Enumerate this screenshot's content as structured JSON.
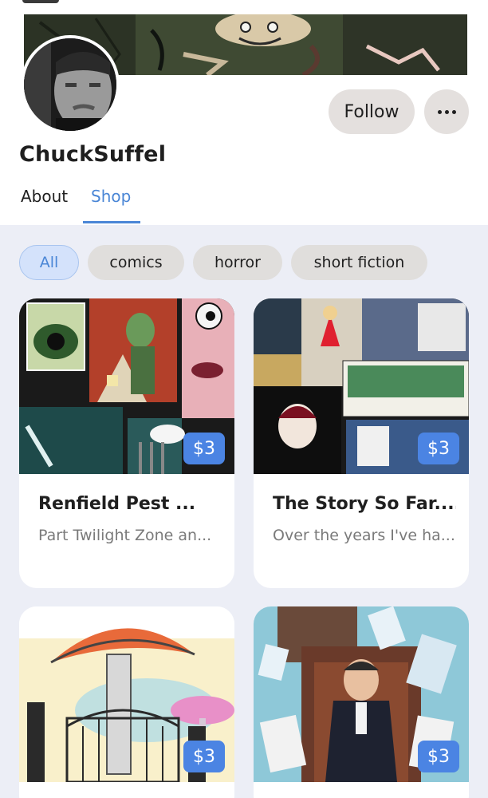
{
  "profile": {
    "name": "ChuckSuffel",
    "follow_label": "Follow",
    "more_icon": "more-horizontal-icon"
  },
  "tabs": [
    {
      "label": "About",
      "active": false
    },
    {
      "label": "Shop",
      "active": true
    }
  ],
  "filters": [
    {
      "label": "All",
      "selected": true
    },
    {
      "label": "comics",
      "selected": false
    },
    {
      "label": "horror",
      "selected": false
    },
    {
      "label": "short fiction",
      "selected": false
    }
  ],
  "products": [
    {
      "title": "Renfield Pest ...",
      "description": "Part Twilight Zone an...",
      "price": "$3"
    },
    {
      "title": "The Story So Far......",
      "description": "Over the years I've ha...",
      "price": "$3"
    },
    {
      "title": "",
      "description": "",
      "price": "$3"
    },
    {
      "title": "",
      "description": "",
      "price": "$3"
    }
  ],
  "colors": {
    "accent": "#4a86d6",
    "price_badge": "#4b84e3",
    "chip_bg": "#e0dedc",
    "chip_selected_bg": "#d4e2fb",
    "shop_bg": "#eceef6"
  }
}
